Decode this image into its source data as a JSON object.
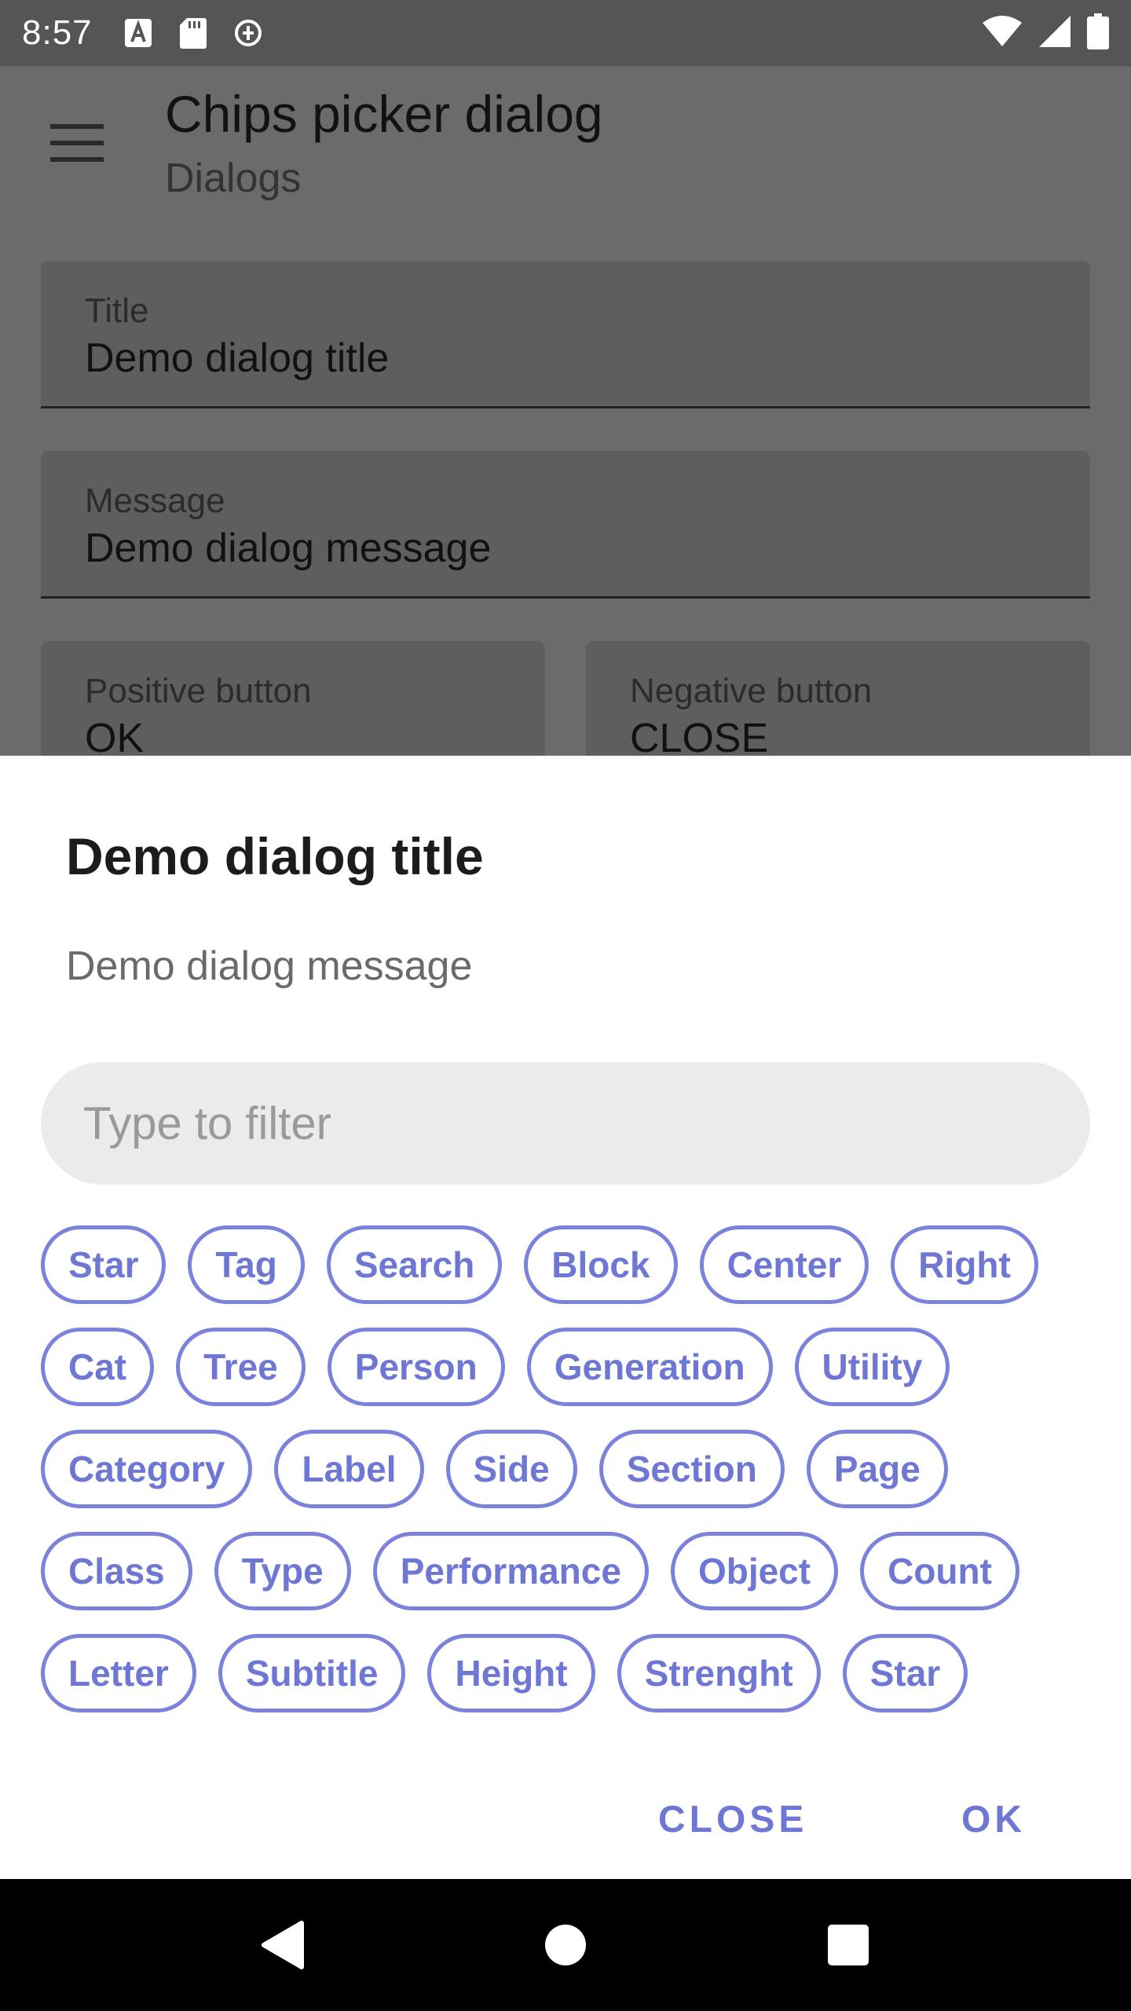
{
  "status_bar": {
    "time": "8:57",
    "left_icons": [
      "text-recognition-icon",
      "sd-card-icon",
      "sync-circle-icon"
    ],
    "right_icons": [
      "wifi-icon",
      "cell-signal-icon",
      "battery-icon"
    ]
  },
  "app_bar": {
    "title": "Chips picker dialog",
    "subtitle": "Dialogs"
  },
  "form": {
    "title_label": "Title",
    "title_value": "Demo dialog title",
    "message_label": "Message",
    "message_value": "Demo dialog message",
    "positive_label": "Positive button",
    "positive_value": "OK",
    "negative_label": "Negative button",
    "negative_value": "CLOSE"
  },
  "dialog": {
    "title": "Demo dialog title",
    "message": "Demo dialog message",
    "filter_placeholder": "Type to filter",
    "filter_value": "",
    "chip_rows": [
      [
        "Star",
        "Tag",
        "Search",
        "Block",
        "Center",
        "Right"
      ],
      [
        "Cat",
        "Tree",
        "Person",
        "Generation",
        "Utility"
      ],
      [
        "Category",
        "Label",
        "Side",
        "Section",
        "Page"
      ],
      [
        "Class",
        "Type",
        "Performance",
        "Object",
        "Count"
      ],
      [
        "Letter",
        "Subtitle",
        "Height",
        "Strenght",
        "Star"
      ]
    ],
    "close_label": "CLOSE",
    "ok_label": "OK"
  },
  "nav_bar": {
    "back_icon": "back-triangle-icon",
    "home_icon": "home-circle-icon",
    "recents_icon": "recents-square-icon"
  },
  "colors": {
    "accent": "#6e77d4",
    "scrim_appbar": "#6b6b6b",
    "status_bar": "#555555"
  }
}
